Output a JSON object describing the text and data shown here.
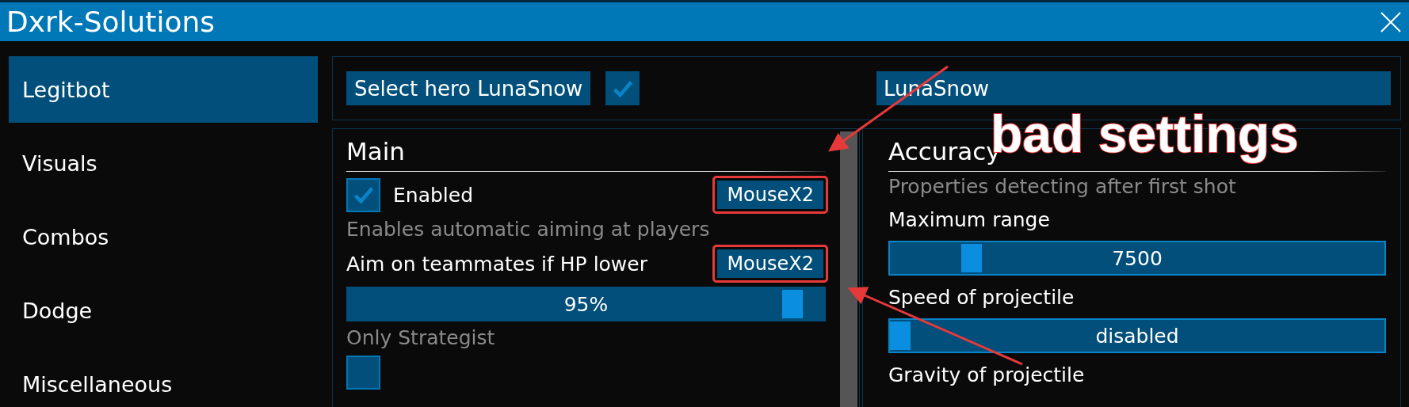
{
  "window": {
    "title": "Dxrk-Solutions"
  },
  "sidebar": {
    "items": [
      {
        "label": "Legitbot",
        "selected": true
      },
      {
        "label": "Visuals",
        "selected": false
      },
      {
        "label": "Combos",
        "selected": false
      },
      {
        "label": "Dodge",
        "selected": false
      },
      {
        "label": "Miscellaneous",
        "selected": false
      }
    ]
  },
  "hero_bar": {
    "button": "Select hero LunaSnow",
    "checked": true,
    "field_value": "LunaSnow"
  },
  "panels": [
    {
      "title": "Main",
      "scrollbar": true,
      "items": [
        {
          "kind": "checkbox",
          "label": "Enabled",
          "checked": true,
          "key": "MouseX2",
          "key_highlighted": true
        },
        {
          "kind": "hint",
          "text": "Enables automatic aiming at players"
        },
        {
          "kind": "label",
          "label": "Aim on teammates if HP lower",
          "key": "MouseX2",
          "key_highlighted": true
        },
        {
          "kind": "slider",
          "level": 0.95,
          "reading": "95%",
          "outlined": false
        },
        {
          "kind": "hint",
          "text": "Only Strategist"
        },
        {
          "kind": "checkbox",
          "checked": false
        }
      ]
    },
    {
      "title": "Accuracy",
      "scrollbar": false,
      "items": [
        {
          "kind": "hint",
          "text": "Properties detecting after first shot"
        },
        {
          "kind": "label",
          "label": "Maximum range"
        },
        {
          "kind": "slider",
          "level": 0.15,
          "reading": "7500",
          "outlined": true
        },
        {
          "kind": "label",
          "label": "Speed of projectile"
        },
        {
          "kind": "slider",
          "level": 0,
          "reading": "disabled",
          "outlined": true
        },
        {
          "kind": "label",
          "label": "Gravity of projectile"
        }
      ]
    }
  ],
  "annotation": {
    "label": "bad settings"
  }
}
